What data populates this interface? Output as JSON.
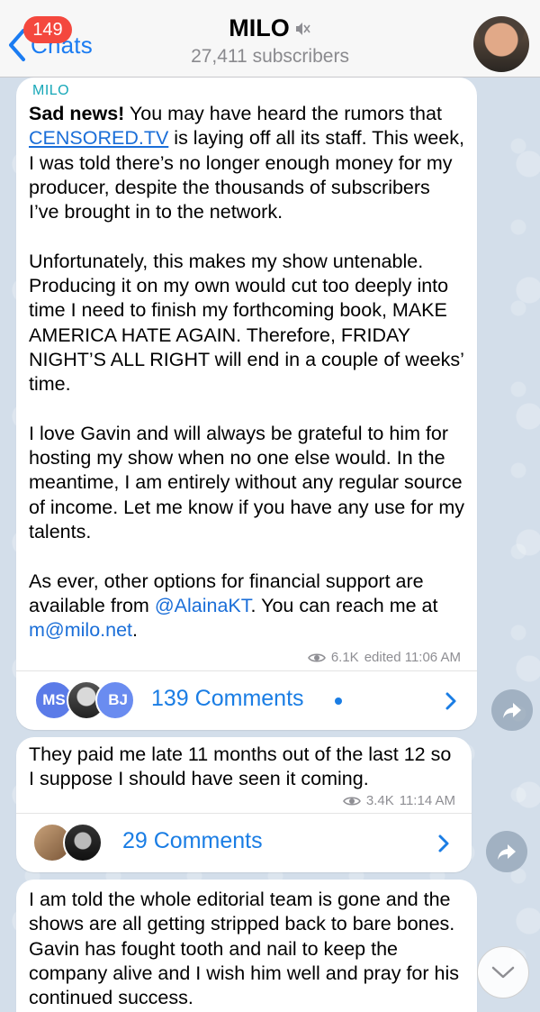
{
  "header": {
    "back_label": "Chats",
    "unread_count": "149",
    "title": "MILO",
    "subtitle": "27,411 subscribers"
  },
  "posts": [
    {
      "sender": "MILO",
      "lead_bold": "Sad news!",
      "p1_before_link": " You may have heard the rumors that ",
      "p1_link": "CENSORED.TV",
      "p1_after_link": " is laying off all its staff. This week, I was told there’s no longer enough money for my producer, despite the thousands of subscribers I’ve brought in to the network.",
      "p2": "Unfortunately, this makes my show untenable. Producing it on my own would cut too deeply into time I need to finish my forthcoming book, MAKE AMERICA HATE AGAIN. Therefore, FRIDAY NIGHT’S ALL RIGHT will end in a couple of weeks’ time.",
      "p3": "I love Gavin and will always be grateful to him for hosting my show when no one else would. In the meantime, I am entirely without any regular source of income. Let me know if you have any use for my talents.",
      "p4_before_mention": "As ever, other options for financial support are available from ",
      "p4_mention": "@AlainaKT",
      "p4_middle": ". You can reach me at ",
      "p4_email": "m@milo.net",
      "p4_end": ".",
      "views": "6.1K",
      "time": "edited 11:06 AM",
      "comments_label": "139 Comments",
      "commenter_initials": [
        "MS",
        "BJ"
      ],
      "commenter_colors": [
        "#5b7be8",
        "#6a8cf0"
      ]
    },
    {
      "text": "They paid me late 11 months out of the last 12 so I suppose I should have seen it coming.",
      "views": "3.4K",
      "time": "11:14 AM",
      "comments_label": "29 Comments"
    },
    {
      "text": "I am told the whole editorial team is gone and the shows are all getting stripped back to bare bones. Gavin has fought tooth and nail to keep the company alive and I wish him well and pray for his continued success."
    }
  ]
}
